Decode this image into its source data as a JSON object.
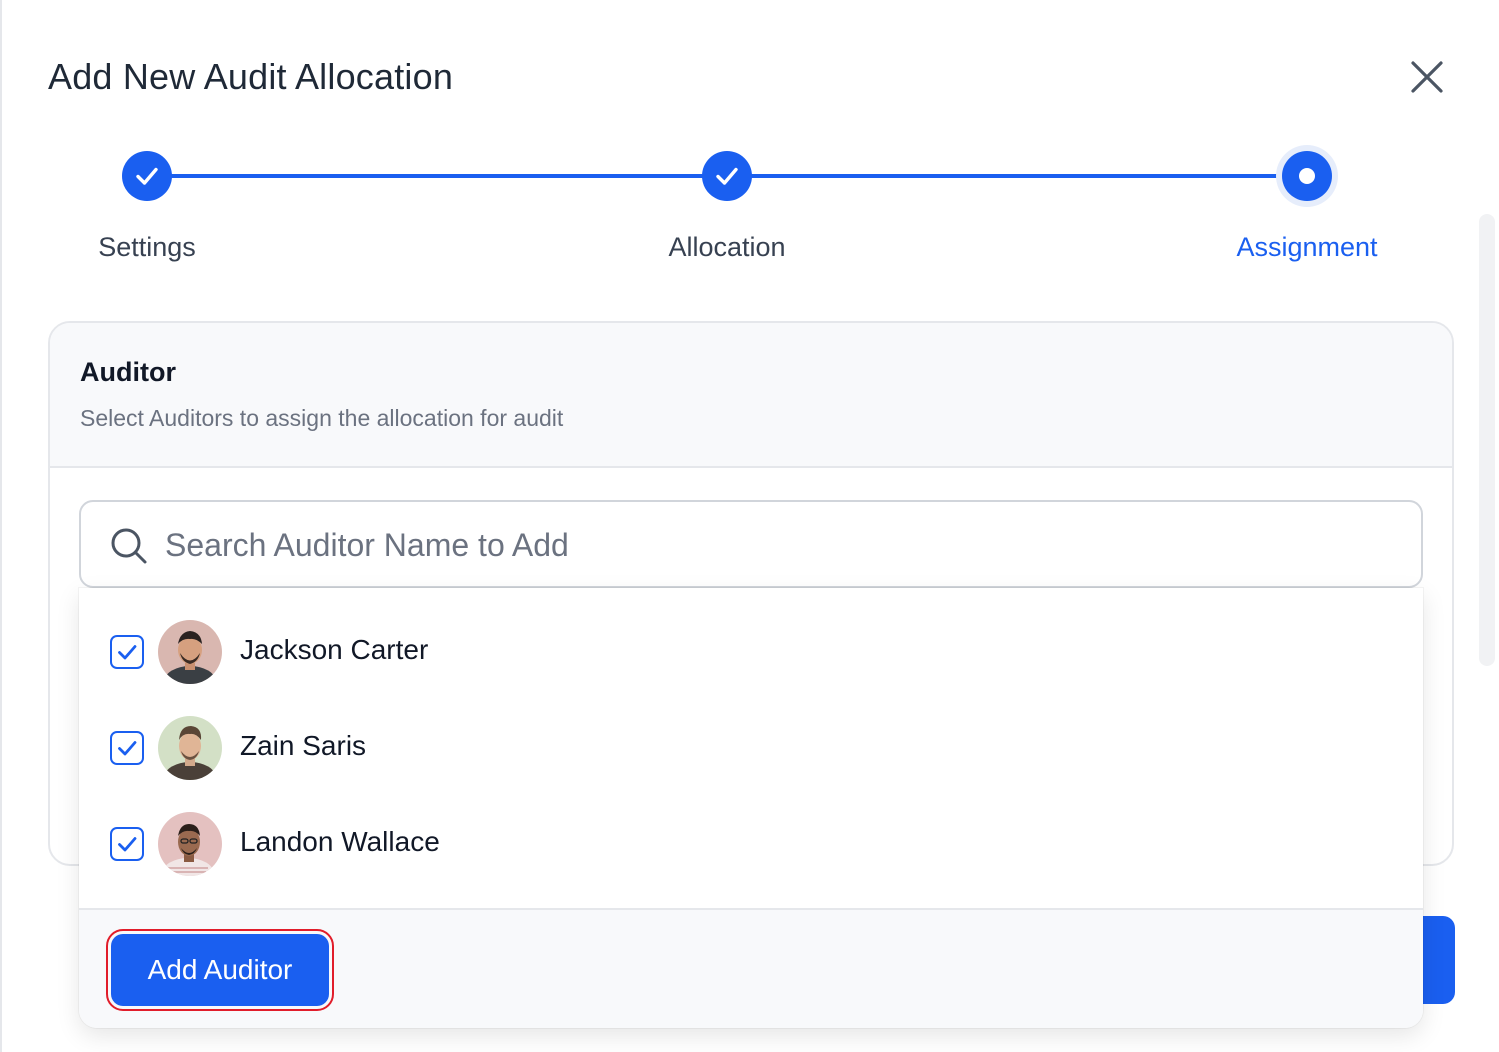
{
  "dialog": {
    "title": "Add New Audit Allocation"
  },
  "stepper": {
    "steps": [
      {
        "label": "Settings",
        "state": "completed"
      },
      {
        "label": "Allocation",
        "state": "completed"
      },
      {
        "label": "Assignment",
        "state": "active"
      }
    ]
  },
  "auditor_section": {
    "title": "Auditor",
    "subtitle": "Select Auditors to assign the allocation for audit"
  },
  "search": {
    "placeholder": "Search Auditor Name to Add",
    "value": ""
  },
  "dropdown": {
    "items": [
      {
        "name": "Jackson Carter",
        "checked": true
      },
      {
        "name": "Zain Saris",
        "checked": true
      },
      {
        "name": "Landon Wallace",
        "checked": true
      }
    ],
    "add_button_label": "Add Auditor"
  },
  "colors": {
    "primary": "#1a5ff0",
    "text_dark": "#1f2937",
    "text_muted": "#6b7280",
    "highlight_outline": "#e11d2a"
  }
}
